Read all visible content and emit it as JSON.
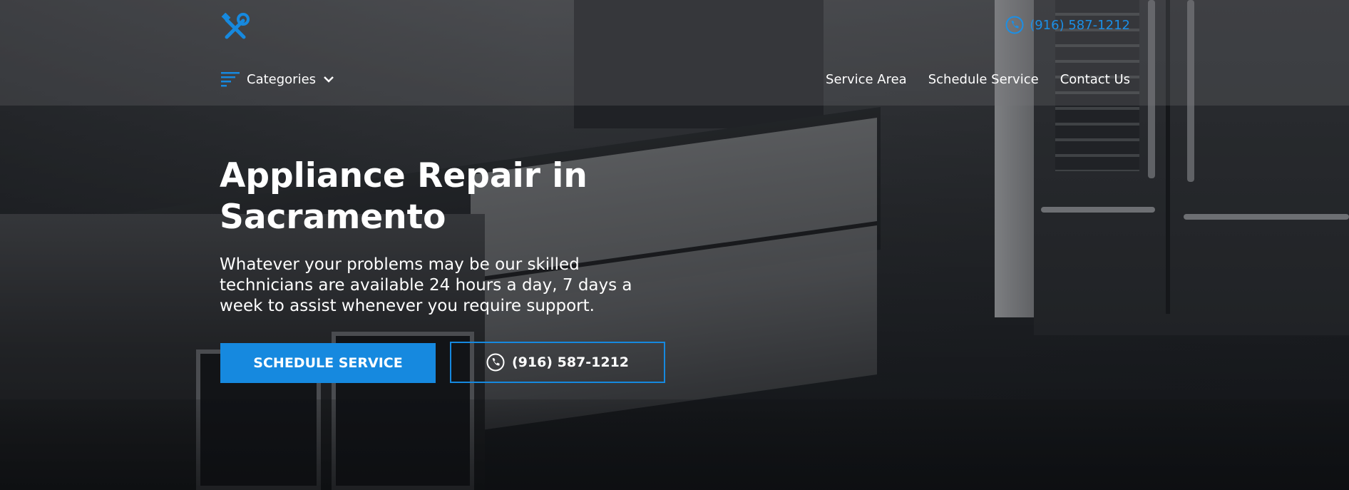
{
  "header": {
    "logo_icon": "tools-icon",
    "phone": "(916) 587-1212",
    "accent_color": "#1689df"
  },
  "nav": {
    "categories_label": "Categories",
    "links": [
      "Service Area",
      "Schedule Service",
      "Contact Us"
    ]
  },
  "hero": {
    "title": "Appliance Repair in Sacramento",
    "subtitle": "Whatever your problems may be our skilled technicians are available 24 hours a day, 7 days a week to assist whenever you require support.",
    "primary_button": "SCHEDULE SERVICE",
    "phone_button": "(916) 587-1212"
  }
}
